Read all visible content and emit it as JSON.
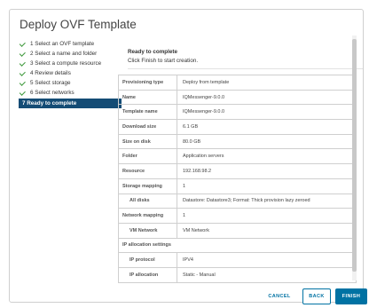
{
  "dialog": {
    "title": "Deploy OVF Template"
  },
  "steps": [
    {
      "label": "1 Select an OVF template",
      "done": true
    },
    {
      "label": "2 Select a name and folder",
      "done": true
    },
    {
      "label": "3 Select a compute resource",
      "done": true
    },
    {
      "label": "4 Review details",
      "done": true
    },
    {
      "label": "5 Select storage",
      "done": true
    },
    {
      "label": "6 Select networks",
      "done": true
    },
    {
      "label": "7 Ready to complete",
      "done": false,
      "active": true
    }
  ],
  "content": {
    "title": "Ready to complete",
    "subtitle": "Click Finish to start creation."
  },
  "table": {
    "rows": [
      {
        "key": "Provisioning type",
        "value": "Deploy from template"
      },
      {
        "key": "Name",
        "value": "IQMessenger-9.0.0"
      },
      {
        "key": "Template name",
        "value": "IQMessenger-9.0.0"
      },
      {
        "key": "Download size",
        "value": "6.1 GB"
      },
      {
        "key": "Size on disk",
        "value": "80.0 GB"
      },
      {
        "key": "Folder",
        "value": "Application servers"
      },
      {
        "key": "Resource",
        "value": "192.168.98.2"
      },
      {
        "key": "Storage mapping",
        "value": "1"
      },
      {
        "key": "All disks",
        "value": "Datastore: Datastore3; Format: Thick provision lazy zeroed",
        "sub": true
      },
      {
        "key": "Network mapping",
        "value": "1"
      },
      {
        "key": "VM Network",
        "value": "VM Network",
        "sub": true
      },
      {
        "key": "IP allocation settings",
        "value": "",
        "section": true
      },
      {
        "key": "IP protocol",
        "value": "IPV4",
        "sub": true
      },
      {
        "key": "IP allocation",
        "value": "Static - Manual",
        "sub": true
      }
    ]
  },
  "footer": {
    "cancel_label": "CANCEL",
    "back_label": "BACK",
    "finish_label": "FINISH"
  },
  "colors": {
    "accent": "#0072a3",
    "active_step_bg": "#144c75",
    "check": "#3f9a3c"
  }
}
